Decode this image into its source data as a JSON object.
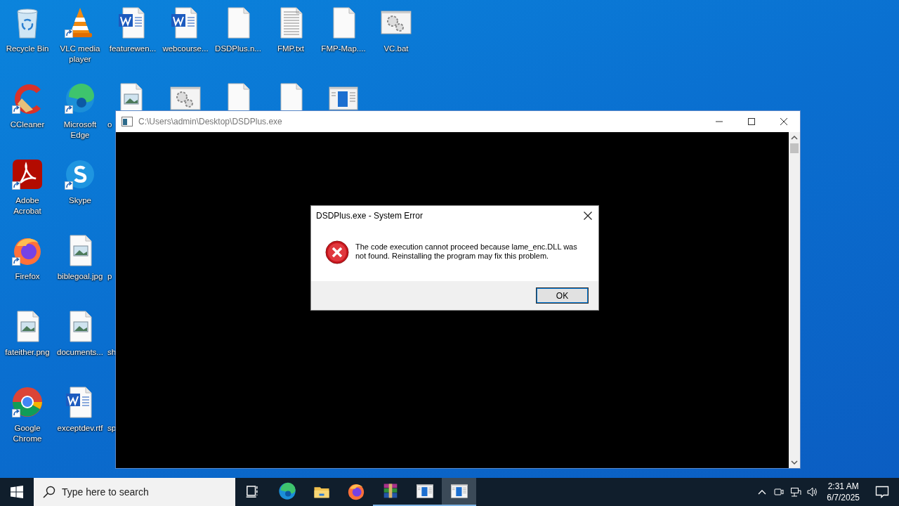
{
  "desktop": {
    "rows": [
      [
        {
          "kind": "recycle-bin",
          "label": "Recycle Bin",
          "shortcut": false
        },
        {
          "kind": "vlc",
          "label": "VLC media player",
          "shortcut": true
        },
        {
          "kind": "word",
          "label": "featurewen...",
          "shortcut": false
        },
        {
          "kind": "word",
          "label": "webcourse...",
          "shortcut": false
        },
        {
          "kind": "blank",
          "label": "DSDPlus.n...",
          "shortcut": false
        },
        {
          "kind": "text",
          "label": "FMP.txt",
          "shortcut": false
        },
        {
          "kind": "blank",
          "label": "FMP-Map....",
          "shortcut": false
        },
        {
          "kind": "gear",
          "label": "VC.bat",
          "shortcut": false
        }
      ],
      [
        {
          "kind": "ccleaner",
          "label": "CCleaner",
          "shortcut": true
        },
        {
          "kind": "edge",
          "label": "Microsoft Edge",
          "shortcut": true
        },
        {
          "kind": "image",
          "label": "o",
          "shortcut": false
        },
        {
          "kind": "gear",
          "shortcut": false
        },
        {
          "kind": "blank",
          "shortcut": false
        },
        {
          "kind": "blank",
          "shortcut": false
        },
        {
          "kind": "app-window",
          "shortcut": false
        }
      ],
      [
        {
          "kind": "acrobat",
          "label": "Adobe Acrobat",
          "shortcut": true
        },
        {
          "kind": "skype",
          "label": "Skype",
          "shortcut": true
        }
      ],
      [
        {
          "kind": "firefox",
          "label": "Firefox",
          "shortcut": true
        },
        {
          "kind": "image",
          "label": "biblegoal.jpg",
          "shortcut": false
        },
        {
          "kind": "hidden",
          "label": "p"
        }
      ],
      [
        {
          "kind": "image",
          "label": "fateither.png",
          "shortcut": false
        },
        {
          "kind": "image",
          "label": "documents...",
          "shortcut": false
        },
        {
          "kind": "hidden",
          "label": "sh"
        }
      ],
      [
        {
          "kind": "chrome",
          "label": "Google Chrome",
          "shortcut": true
        },
        {
          "kind": "word",
          "label": "exceptdev.rtf",
          "shortcut": false
        },
        {
          "kind": "hidden",
          "label": "sp"
        }
      ]
    ]
  },
  "console_window": {
    "title": "C:\\Users\\admin\\Desktop\\DSDPlus.exe"
  },
  "dialog": {
    "title": "DSDPlus.exe - System Error",
    "message": "The code execution cannot proceed because lame_enc.DLL was not found. Reinstalling the program may fix this problem.",
    "button": "OK"
  },
  "taskbar": {
    "search": {
      "placeholder": "Type here to search"
    },
    "apps": [
      {
        "kind": "task-view",
        "running": false,
        "selected": false
      },
      {
        "kind": "edge",
        "running": false,
        "selected": false
      },
      {
        "kind": "explorer",
        "running": false,
        "selected": false
      },
      {
        "kind": "firefox",
        "running": false,
        "selected": false
      },
      {
        "kind": "winrar",
        "running": true,
        "selected": false
      },
      {
        "kind": "app-window",
        "running": true,
        "selected": false
      },
      {
        "kind": "app-window",
        "running": true,
        "selected": true
      }
    ],
    "clock": {
      "time": "2:31 AM",
      "date": "6/7/2025"
    }
  }
}
